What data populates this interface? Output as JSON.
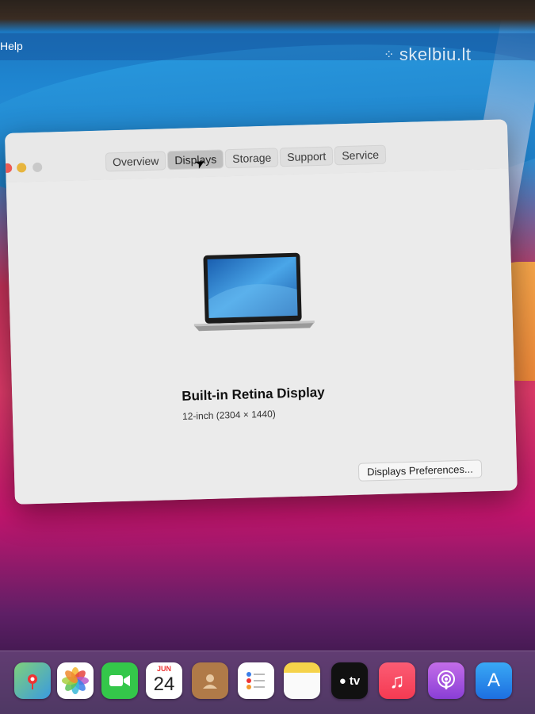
{
  "menubar": {
    "help_label": "Help"
  },
  "watermark": {
    "text": "skelbiu.lt"
  },
  "window": {
    "tabs": [
      {
        "label": "Overview",
        "selected": false
      },
      {
        "label": "Displays",
        "selected": true
      },
      {
        "label": "Storage",
        "selected": false
      },
      {
        "label": "Support",
        "selected": false
      },
      {
        "label": "Service",
        "selected": false
      }
    ],
    "display_name": "Built-in Retina Display",
    "display_resolution": "12-inch (2304 × 1440)",
    "preferences_button": "Displays Preferences..."
  },
  "dock": {
    "items": [
      {
        "name": "maps-icon",
        "glyph": ""
      },
      {
        "name": "photos-icon",
        "glyph": ""
      },
      {
        "name": "facetime-icon",
        "glyph": ""
      },
      {
        "name": "calendar-icon",
        "month": "JUN",
        "day": "24"
      },
      {
        "name": "contacts-icon",
        "glyph": ""
      },
      {
        "name": "reminders-icon",
        "glyph": ""
      },
      {
        "name": "notes-icon",
        "glyph": ""
      },
      {
        "name": "apple-tv-icon",
        "glyph": "tv"
      },
      {
        "name": "music-icon",
        "glyph": "♫"
      },
      {
        "name": "podcasts-icon",
        "glyph": ""
      },
      {
        "name": "app-store-icon",
        "glyph": "A"
      }
    ]
  },
  "colors": {
    "window_bg": "#ececec",
    "close_button": "#ec5b54",
    "minimize_button": "#e7b53e"
  }
}
